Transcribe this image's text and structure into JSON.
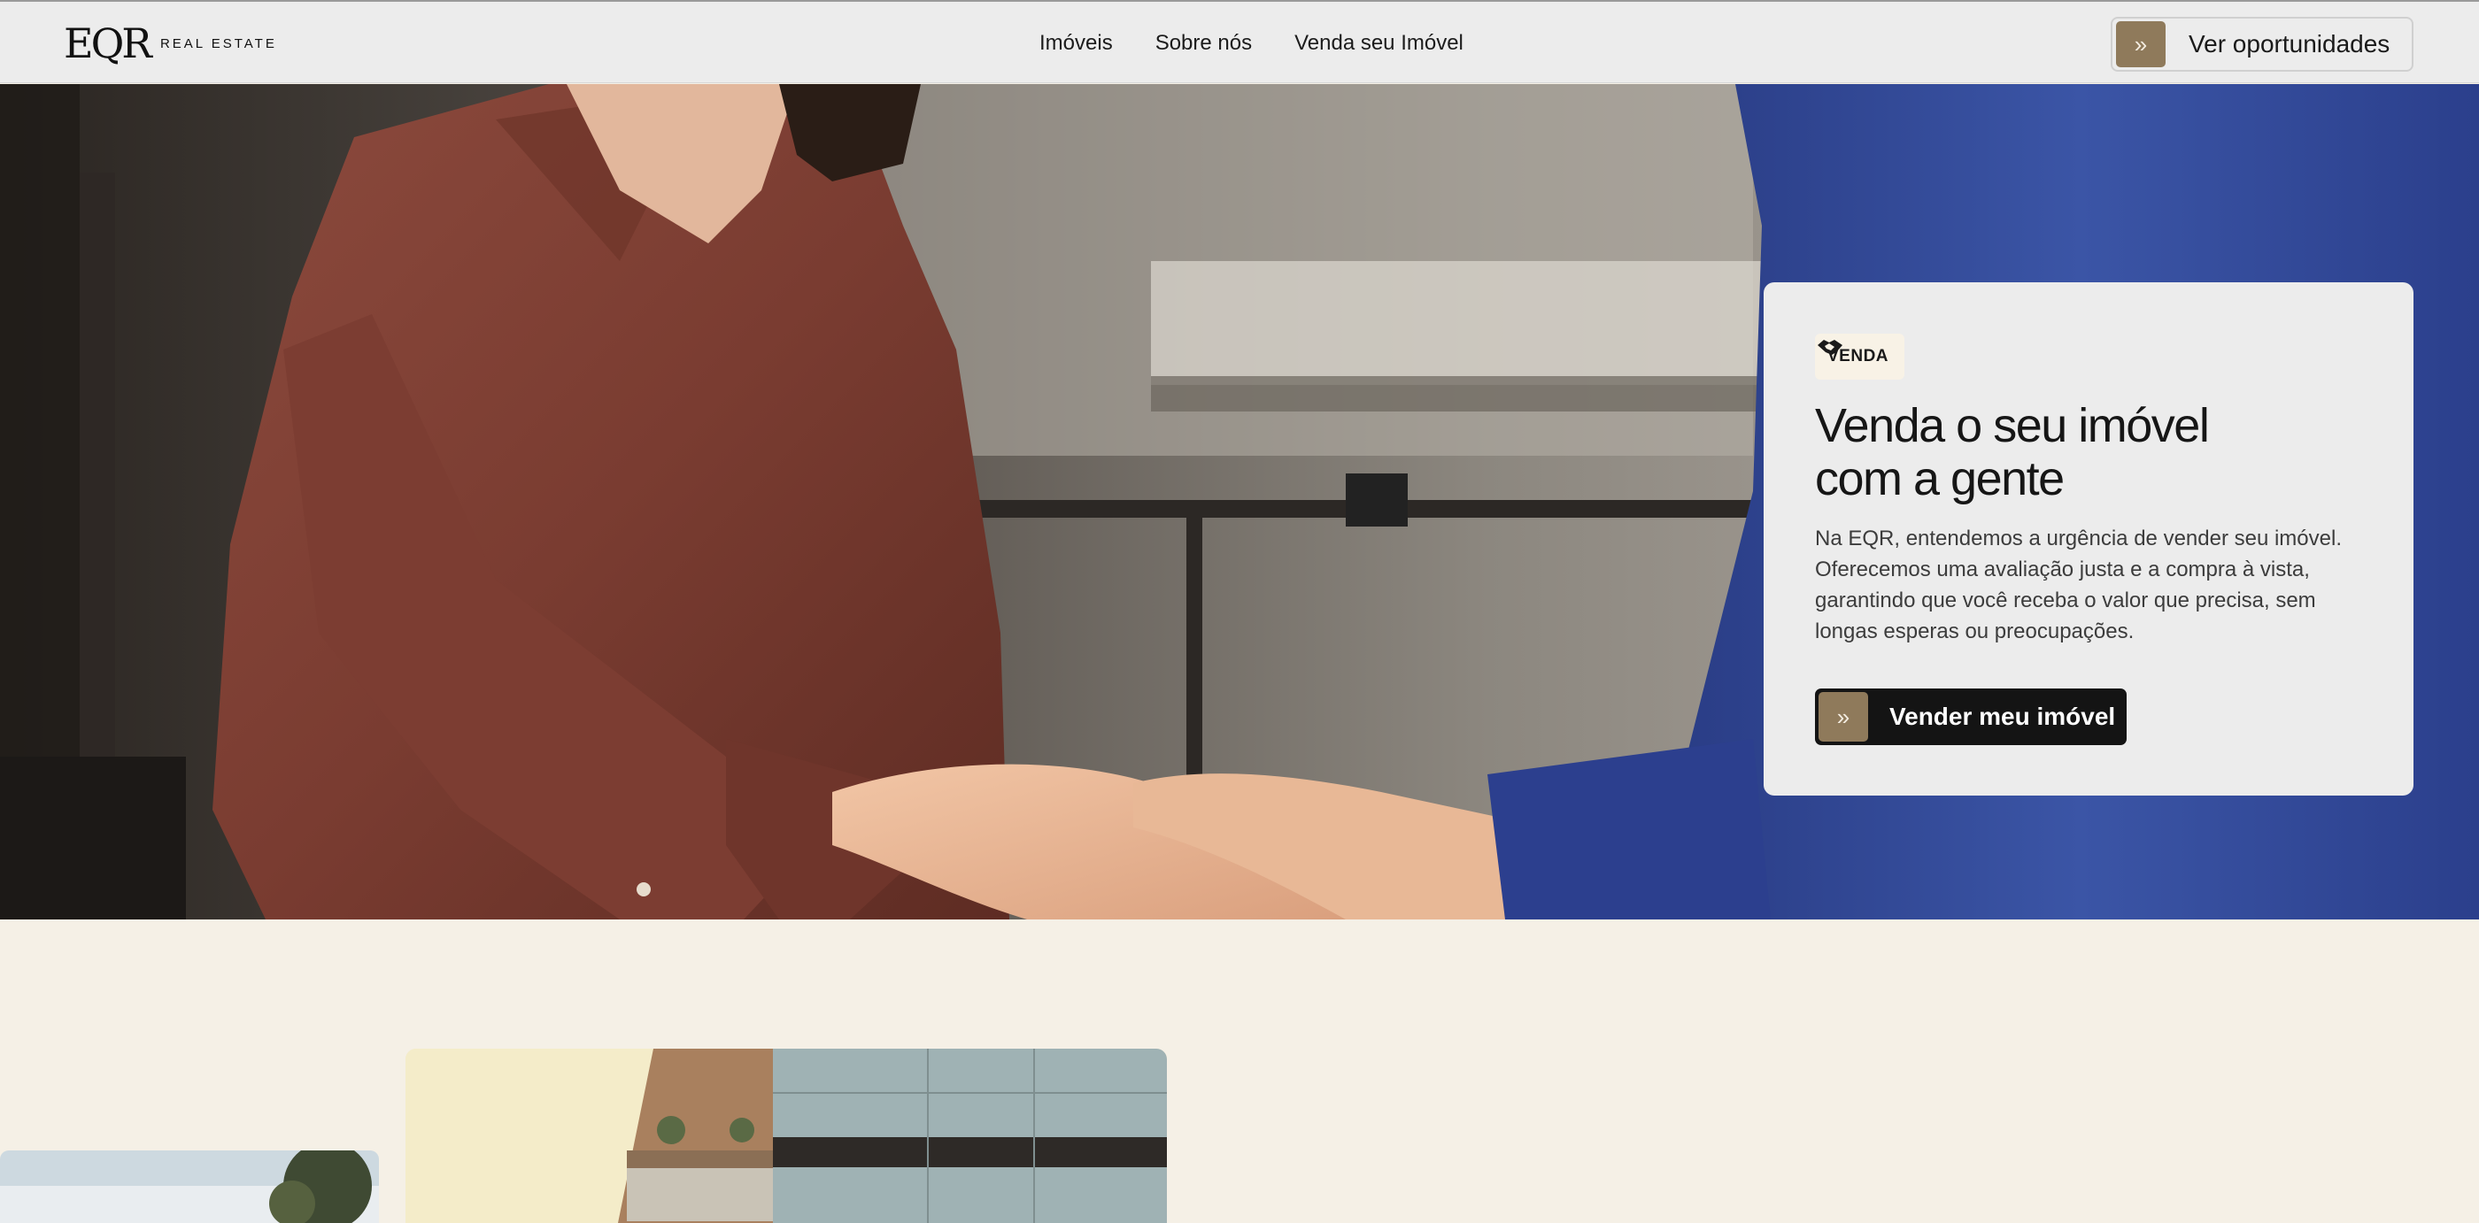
{
  "header": {
    "logo_mark": "EQR",
    "logo_text": "REAL ESTATE",
    "nav": [
      {
        "label": "Imóveis"
      },
      {
        "label": "Sobre nós"
      },
      {
        "label": "Venda seu Imóvel"
      }
    ],
    "cta_label": "Ver oportunidades",
    "cta_icon": "double-chevron-right-icon"
  },
  "hero": {
    "tag_icon": "handshake-icon",
    "tag_label": "VENDA",
    "title_line1": "Venda o seu imóvel",
    "title_line2": "com a gente",
    "description": "Na EQR, entendemos a urgência de vender seu imóvel. Oferecemos uma avaliação justa e a compra à vista, garantindo que você receba o valor que precisa, sem longas esperas ou preocupações.",
    "cta_label": "Vender meu imóvel",
    "cta_icon": "double-chevron-right-icon"
  },
  "colors": {
    "accent": "#8f7a5b",
    "header_bg": "#ececec",
    "page_bg": "#f5f0e6",
    "dark_button": "#141414"
  }
}
